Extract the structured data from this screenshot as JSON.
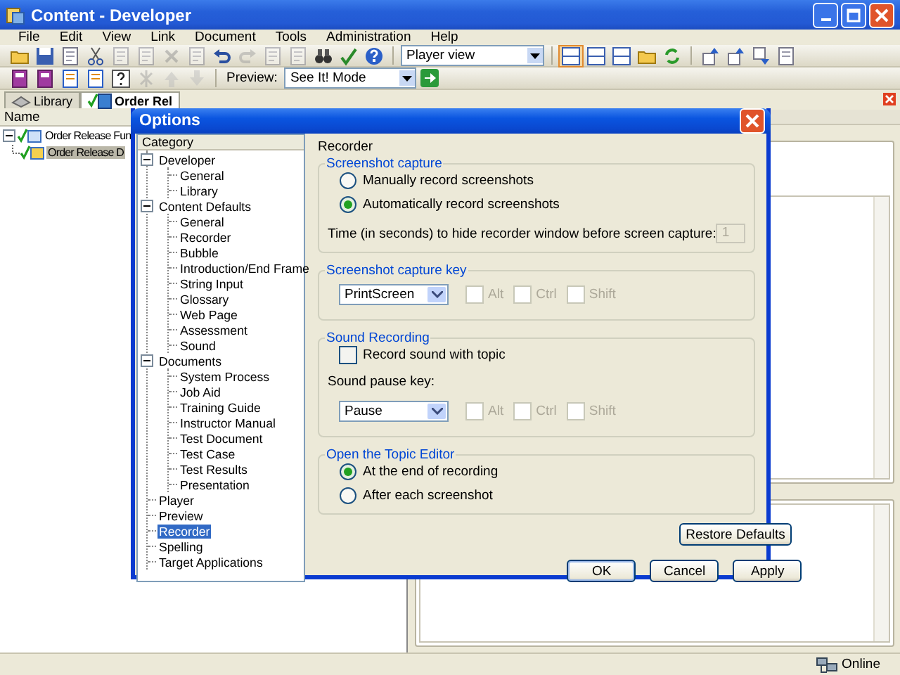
{
  "window": {
    "title": "Content - Developer"
  },
  "menu": [
    "File",
    "Edit",
    "View",
    "Link",
    "Document",
    "Tools",
    "Administration",
    "Help"
  ],
  "toolbar": {
    "view_select": "Player view",
    "preview_label": "Preview:",
    "preview_select": "See It! Mode"
  },
  "tabs": [
    {
      "label": "Library",
      "selected": false
    },
    {
      "label": "Order Rel",
      "selected": true
    }
  ],
  "outline": {
    "column": "Name",
    "items": [
      {
        "label": "Order Release Fun",
        "selected": false,
        "children": [
          {
            "label": "Order Release D",
            "selected": true
          }
        ]
      }
    ]
  },
  "dialog": {
    "title": "Options",
    "category_header": "Category",
    "categories": [
      {
        "label": "Developer",
        "selected": false,
        "expanded": true,
        "children": [
          {
            "label": "General",
            "selected": false
          },
          {
            "label": "Library",
            "selected": false
          }
        ]
      },
      {
        "label": "Content Defaults",
        "selected": false,
        "expanded": true,
        "children": [
          {
            "label": "General",
            "selected": false
          },
          {
            "label": "Recorder",
            "selected": false
          },
          {
            "label": "Bubble",
            "selected": false
          },
          {
            "label": "Introduction/End Frame",
            "selected": false
          },
          {
            "label": "String Input",
            "selected": false
          },
          {
            "label": "Glossary",
            "selected": false
          },
          {
            "label": "Web Page",
            "selected": false
          },
          {
            "label": "Assessment",
            "selected": false
          },
          {
            "label": "Sound",
            "selected": false
          }
        ]
      },
      {
        "label": "Documents",
        "selected": false,
        "expanded": true,
        "children": [
          {
            "label": "System Process",
            "selected": false
          },
          {
            "label": "Job Aid",
            "selected": false
          },
          {
            "label": "Training Guide",
            "selected": false
          },
          {
            "label": "Instructor Manual",
            "selected": false
          },
          {
            "label": "Test Document",
            "selected": false
          },
          {
            "label": "Test Case",
            "selected": false
          },
          {
            "label": "Test Results",
            "selected": false
          },
          {
            "label": "Presentation",
            "selected": false
          }
        ]
      },
      {
        "label": "Player",
        "selected": false
      },
      {
        "label": "Preview",
        "selected": false
      },
      {
        "label": "Recorder",
        "selected": true
      },
      {
        "label": "Spelling",
        "selected": false
      },
      {
        "label": "Target Applications",
        "selected": false
      }
    ],
    "page_title": "Recorder",
    "groups": [
      {
        "title": "Screenshot capture",
        "rows": [
          {
            "kind": "radio",
            "label": "Manually record screenshots",
            "selected": false
          },
          {
            "kind": "radio",
            "label": "Automatically record screenshots",
            "selected": true
          },
          {
            "kind": "number",
            "label": "Time (in seconds) to hide recorder window before screen capture:",
            "value": "1",
            "disabled": true
          }
        ]
      },
      {
        "title": "Screenshot capture key",
        "rows": [
          {
            "kind": "keycombo",
            "value": "PrintScreen",
            "modifiers": [
              {
                "label": "Alt",
                "checked": false,
                "disabled": true
              },
              {
                "label": "Ctrl",
                "checked": false,
                "disabled": true
              },
              {
                "label": "Shift",
                "checked": false,
                "disabled": true
              }
            ]
          }
        ]
      },
      {
        "title": "Sound Recording",
        "rows": [
          {
            "kind": "checkbox",
            "label": "Record sound with topic",
            "checked": false
          },
          {
            "kind": "label",
            "label": "Sound pause key:"
          },
          {
            "kind": "keycombo",
            "value": "Pause",
            "modifiers": [
              {
                "label": "Alt",
                "checked": false,
                "disabled": true
              },
              {
                "label": "Ctrl",
                "checked": false,
                "disabled": true
              },
              {
                "label": "Shift",
                "checked": false,
                "disabled": true
              }
            ]
          }
        ]
      },
      {
        "title": "Open the Topic Editor",
        "rows": [
          {
            "kind": "radio",
            "label": "At the end of recording",
            "selected": true
          },
          {
            "kind": "radio",
            "label": "After each screenshot",
            "selected": false
          }
        ]
      }
    ],
    "restore_button": "Restore Defaults",
    "buttons": [
      "OK",
      "Cancel",
      "Apply"
    ]
  },
  "status_bar": {
    "text": "Online"
  }
}
